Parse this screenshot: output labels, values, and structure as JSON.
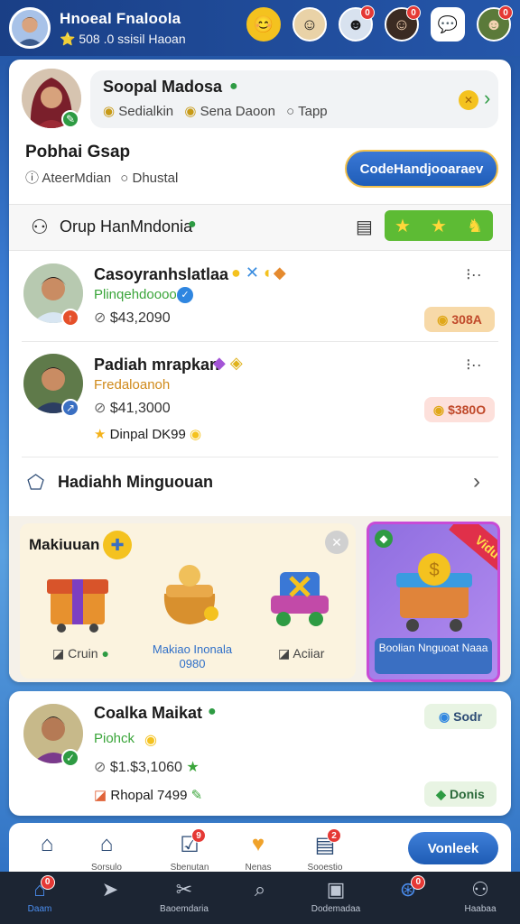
{
  "header": {
    "name": "Hnoeal Fnaloola",
    "sub": "⭐ 508  .0 ssisil Haoan",
    "icons": [
      {
        "name": "coin-icon",
        "glyph": "😊",
        "badge": ""
      },
      {
        "name": "friend-avatar-icon",
        "glyph": "☺",
        "badge": ""
      },
      {
        "name": "friend-avatar-icon-2",
        "glyph": "☻",
        "badge": "0"
      },
      {
        "name": "friend-avatar-icon-3",
        "glyph": "☺",
        "badge": "0"
      },
      {
        "name": "chat-icon",
        "glyph": "💬",
        "badge": ""
      },
      {
        "name": "friend-avatar-icon-4",
        "glyph": "☻",
        "badge": "0"
      }
    ]
  },
  "profile": {
    "name": "Soopal Madosa",
    "meta1": "Sedialkin",
    "meta2": "Sena Daoon",
    "meta3": "Tapp",
    "arrow": "›"
  },
  "groups": {
    "title": "Pobhai Gsap",
    "meta1": "AteerMdian",
    "meta2": "Dhustal",
    "button": "CodeHandjooaraev"
  },
  "group_header": {
    "title": "Orup HanMndonia"
  },
  "users": [
    {
      "name": "Casoyranhslatlaa",
      "sub": "Plinqehdoooo",
      "price": "$43,2090",
      "pill": "308A",
      "more": "⁝··"
    },
    {
      "name": "Padiah mrapkan",
      "sub": "Fredaloanoh",
      "price": "$41,3000",
      "pill": "$380O",
      "extra": "Dinpal DK99",
      "more": "⁝··"
    }
  ],
  "reward": {
    "title": "Hadiahh Minguouan"
  },
  "promo": {
    "title": "Makiuuan",
    "item1": "Cruin",
    "item2": "Makiao Inonala 0980",
    "item3": "Aciiar",
    "purple_label": "Boolian Nnguoat Naaa",
    "ribbon": "Vidu"
  },
  "bottom_card": {
    "name": "Coalka Maikat",
    "sub": "Piohck",
    "price": "$1.$3,1060",
    "extra": "Rhopal 7499",
    "pill1": "Sodr",
    "pill2": "Donis"
  },
  "subnav": {
    "label1": "Sorsulo",
    "label2": "Sbenutan",
    "label3": "Nenas",
    "label4": "Sooestio",
    "button": "Vonleek"
  },
  "bottomnav": [
    {
      "label": "Daam",
      "glyph": "🏠",
      "badge": "0"
    },
    {
      "label": "",
      "glyph": "➤",
      "badge": ""
    },
    {
      "label": "Baoemdaria",
      "glyph": "✂",
      "badge": ""
    },
    {
      "label": "",
      "glyph": "🔍",
      "badge": ""
    },
    {
      "label": "Dodemadaa",
      "glyph": "🖼",
      "badge": ""
    },
    {
      "label": "",
      "glyph": "🧭",
      "badge": "0"
    },
    {
      "label": "Haabaa",
      "glyph": "👤",
      "badge": ""
    }
  ],
  "colors": {
    "accent": "#1f5db8",
    "green": "#5dbb34",
    "pill_orange": "#f7d9a8",
    "pill_red": "#fde0db",
    "nav_bg": "#1c2533"
  }
}
